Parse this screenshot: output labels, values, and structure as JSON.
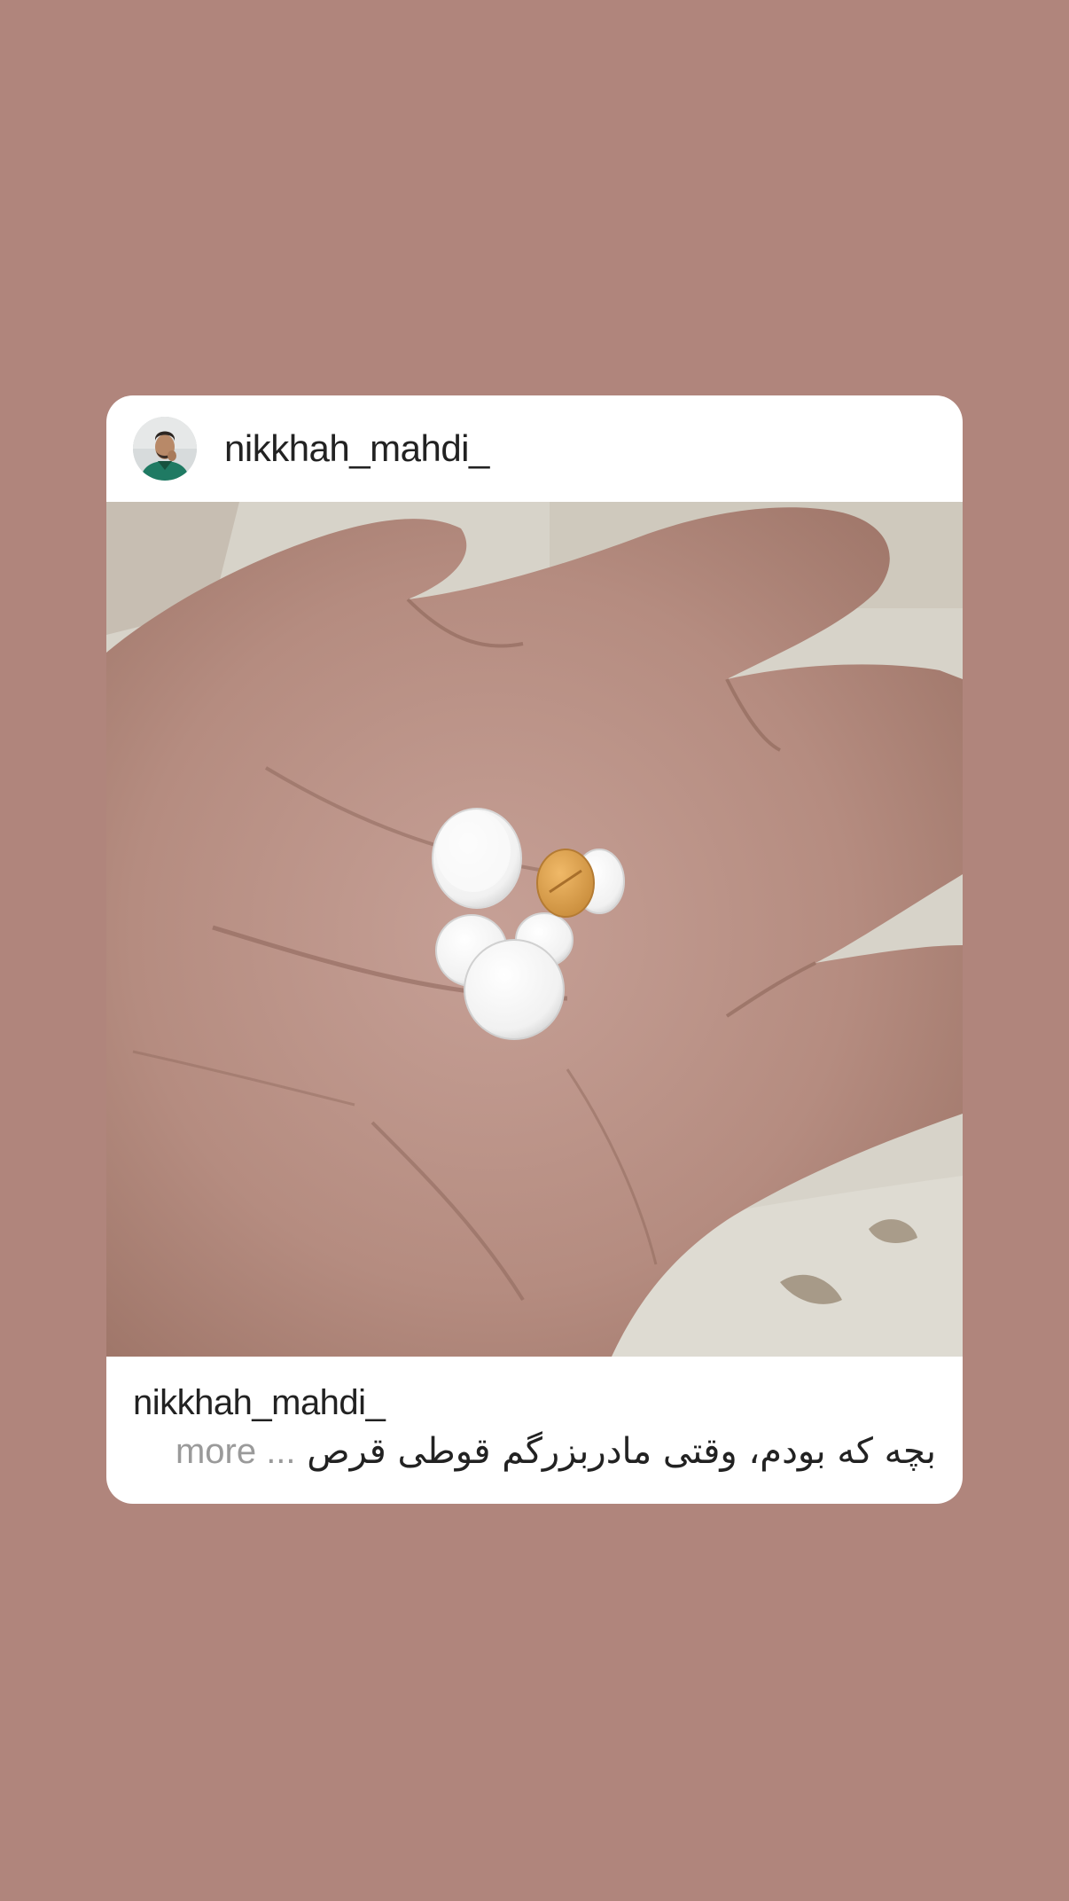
{
  "post": {
    "username": "nikkhah_mahdi_",
    "caption_username": "nikkhah_mahdi_",
    "caption_text": "بچه که بودم، وقتی مادربزرگم قوطی قرص",
    "more_label": "... more",
    "avatar_icon": "profile-avatar",
    "photo_icon": "hand-holding-pills-photo"
  },
  "colors": {
    "background": "#b0857c",
    "card": "#ffffff",
    "text": "#222222",
    "more_text": "#9a9a9a"
  }
}
